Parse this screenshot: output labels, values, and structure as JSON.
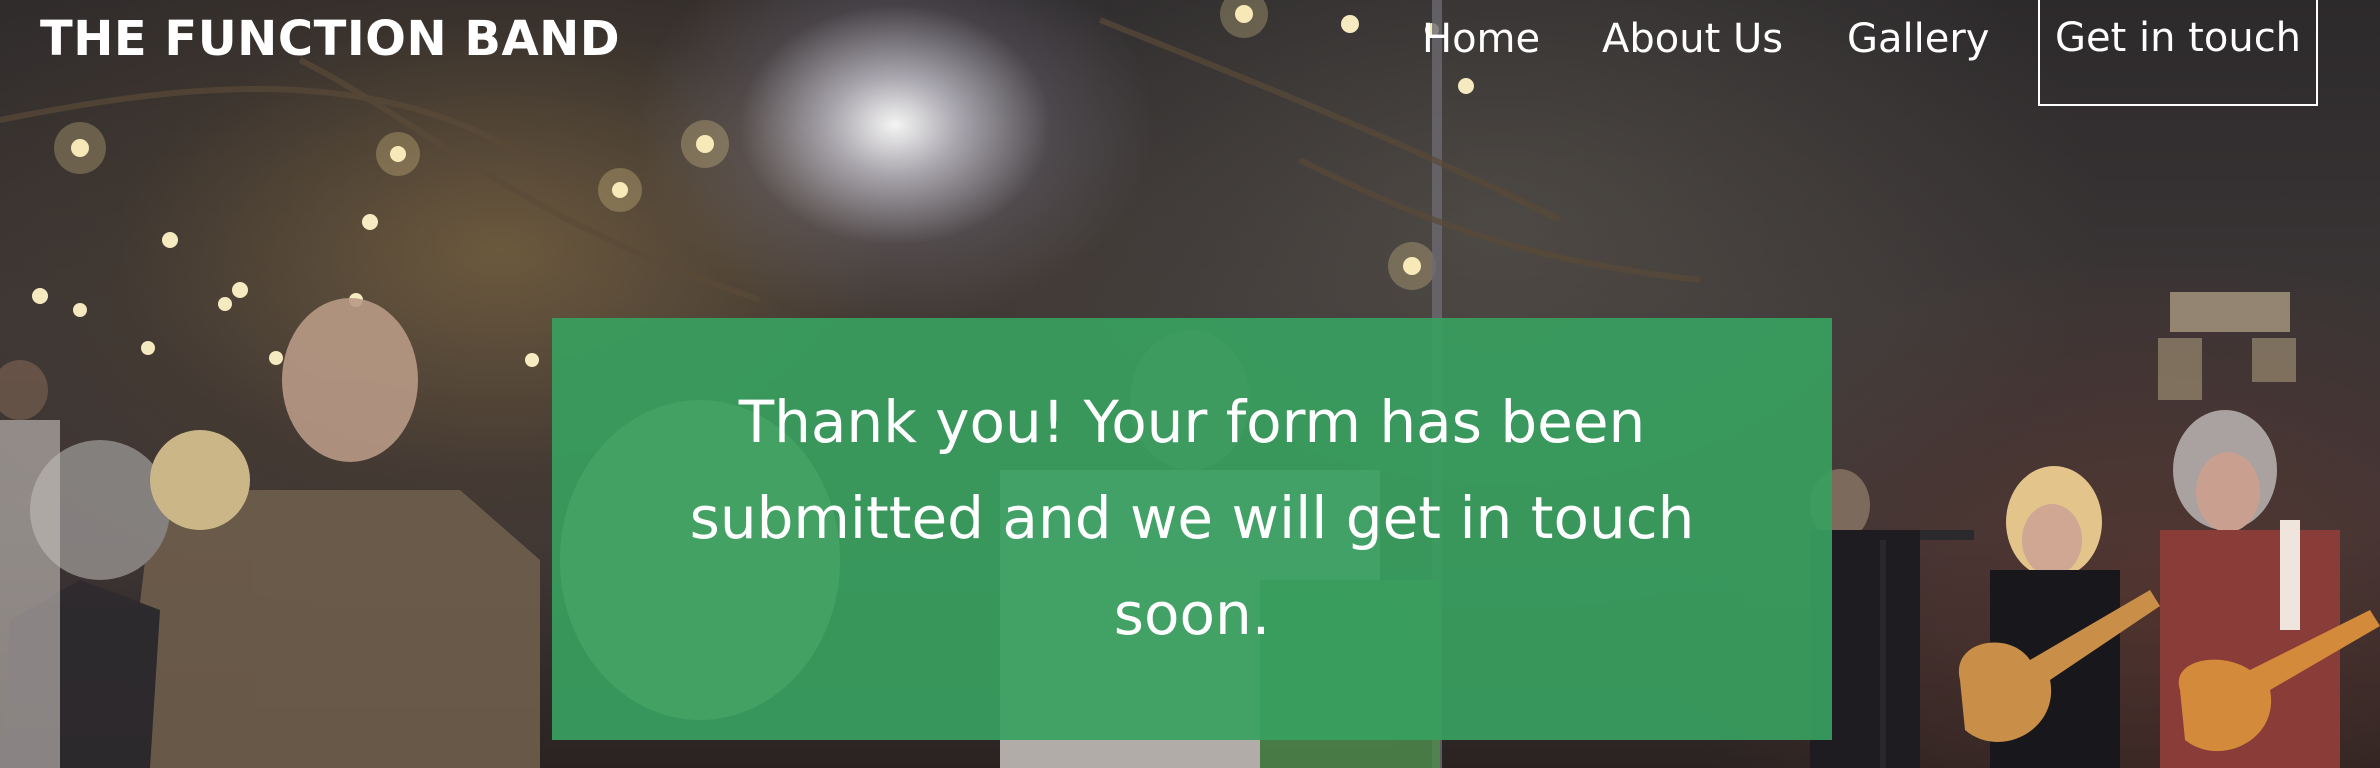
{
  "header": {
    "brand": "THE FUNCTION BAND",
    "nav": [
      {
        "label": "Home"
      },
      {
        "label": "About Us"
      },
      {
        "label": "Gallery"
      }
    ],
    "cta_label": "Get in touch"
  },
  "confirmation": {
    "message": "Thank you! Your form has been submitted and we will get in touch soon."
  },
  "colors": {
    "notice_background": "#38a060",
    "text": "#ffffff"
  }
}
